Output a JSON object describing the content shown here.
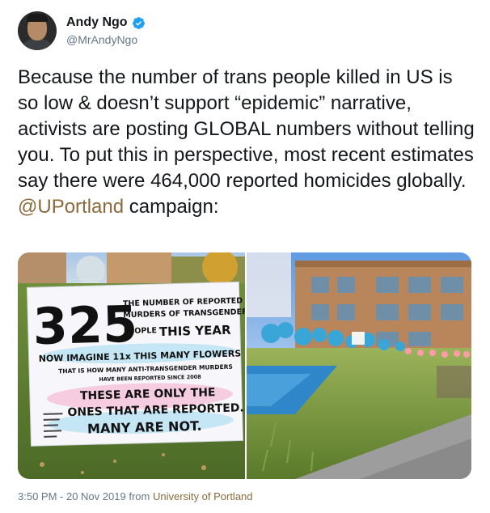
{
  "author": {
    "name": "Andy Ngo",
    "handle": "@MrAndyNgo",
    "verified": true
  },
  "tweet": {
    "text_before_mention": "Because the number of trans people killed in US is so low & doesn’t support “epidemic” narrative, activists are posting GLOBAL numbers without telling you. To put this in perspective, most recent estimates say there were 464,000 reported homicides globally.",
    "mention": "@UPortland",
    "text_after_mention": " campaign:"
  },
  "media": {
    "sign": {
      "number": "325",
      "line1": "THE NUMBER OF REPORTED",
      "line2": "MURDERS OF TRANSGENDER",
      "line3": "PEOPLE",
      "line3b": "THIS YEAR",
      "line4": "NOW IMAGINE 11x THIS MANY FLOWERS",
      "line5": "THAT IS HOW MANY ANTI-TRANSGENDER MURDERS",
      "line6": "HAVE BEEN REPORTED SINCE 2008",
      "line7": "THESE ARE ONLY THE",
      "line8": "ONES THAT ARE REPORTED.",
      "line9": "MANY ARE NOT."
    }
  },
  "footer": {
    "timestamp": "3:50 PM - 20 Nov 2019",
    "from": "from",
    "source": "University of Portland"
  },
  "colors": {
    "mention": "#8b6b3d",
    "verified": "#1da1f2",
    "meta": "#657786"
  }
}
